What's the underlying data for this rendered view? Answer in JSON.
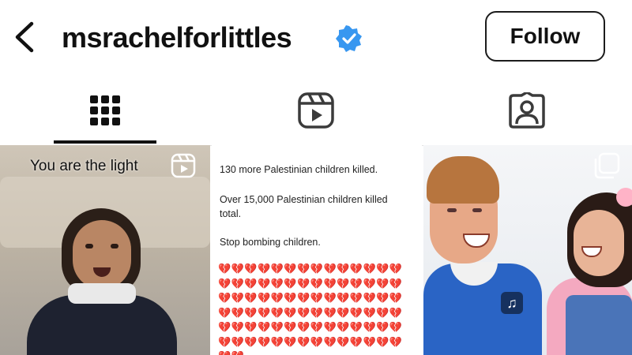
{
  "header": {
    "back_icon": "chevron-left-icon",
    "username": "msrachelforlittles",
    "verified_icon": "verified-badge-icon",
    "follow_label": "Follow"
  },
  "tabs": [
    {
      "name": "grid",
      "icon": "grid-icon",
      "active": true
    },
    {
      "name": "reels",
      "icon": "reels-icon",
      "active": false
    },
    {
      "name": "tagged",
      "icon": "tagged-person-icon",
      "active": false
    }
  ],
  "posts": [
    {
      "type": "reel",
      "caption": "You are the light",
      "badge_icon": "reel-icon"
    },
    {
      "type": "text",
      "lines": [
        "130 more Palestinian children killed.",
        "Over 15,000 Palestinian children killed",
        "total.",
        "Stop bombing children."
      ],
      "hearts": "💔💔💔💔💔💔💔💔💔💔💔💔💔💔💔💔💔💔💔💔💔💔💔💔💔💔💔💔💔💔💔💔💔💔💔💔💔💔💔💔💔💔💔💔💔💔💔💔💔💔💔💔💔💔💔💔💔💔💔💔💔💔💔💔💔💔💔💔💔💔💔💔💔💔💔💔💔💔💔💔💔💔💔💔💔💔"
    },
    {
      "type": "carousel",
      "badge_icon": "multiple-posts-icon",
      "shirt_icon": "♫"
    }
  ],
  "colors": {
    "verified_blue": "#3897f0",
    "heart_red": "#c2272d",
    "text": "#111111"
  }
}
